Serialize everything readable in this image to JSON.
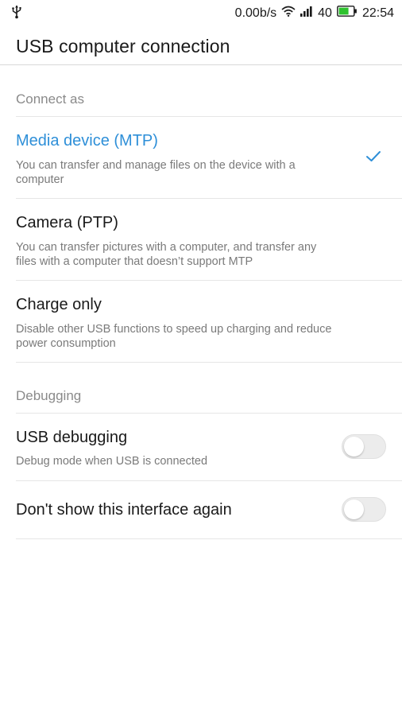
{
  "status_bar": {
    "left_icon": "usb-icon",
    "speed": "0.00b/s",
    "wifi_icon": "wifi-icon",
    "signal_icon": "signal-icon",
    "battery_level": "40",
    "battery_icon": "battery-icon",
    "time": "22:54"
  },
  "app_bar": {
    "title": "USB computer connection"
  },
  "connect_section": {
    "header": "Connect as",
    "options": [
      {
        "title": "Media device (MTP)",
        "description": "You can transfer and manage files on the device with a computer",
        "selected": true
      },
      {
        "title": "Camera (PTP)",
        "description": "You can transfer pictures with a computer, and transfer any files with a computer that doesn’t support MTP",
        "selected": false
      },
      {
        "title": "Charge only",
        "description": "Disable other USB functions to speed up charging and reduce power consumption",
        "selected": false
      }
    ]
  },
  "debug_section": {
    "header": "Debugging",
    "usb_debugging": {
      "title": "USB debugging",
      "description": "Debug mode when USB is connected",
      "enabled": false
    },
    "dont_show": {
      "title": "Don't show this interface again",
      "enabled": false
    }
  },
  "colors": {
    "accent": "#2e8fd8",
    "battery_green": "#2ec22e"
  }
}
